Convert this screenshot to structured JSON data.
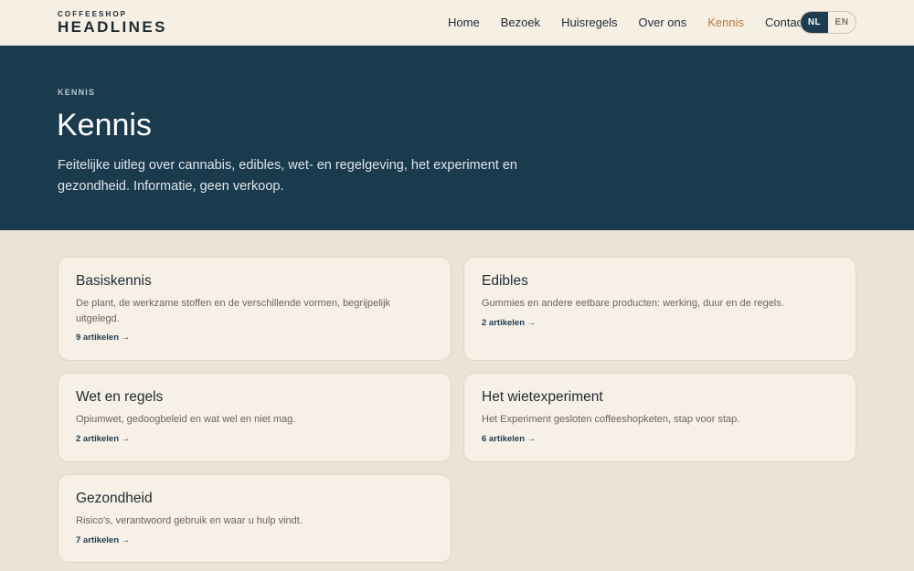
{
  "header": {
    "logo_small": "COFFEESHOP",
    "logo_big": "HEADLINES",
    "nav": [
      {
        "label": "Home"
      },
      {
        "label": "Bezoek"
      },
      {
        "label": "Huisregels"
      },
      {
        "label": "Over ons"
      },
      {
        "label": "Kennis"
      },
      {
        "label": "Contact"
      }
    ],
    "active_nav": "Kennis",
    "lang": {
      "nl": "NL",
      "en": "EN",
      "selected": "NL"
    }
  },
  "hero": {
    "breadcrumb": "KENNIS",
    "title": "Kennis",
    "subtitle": "Feitelijke uitleg over cannabis, edibles, wet- en regelgeving, het experiment en gezondheid. Informatie, geen verkoop."
  },
  "cards": [
    {
      "title": "Basiskennis",
      "description": "De plant, de werkzame stoffen en de verschillende vormen, begrijpelijk uitgelegd.",
      "link": "9 artikelen →"
    },
    {
      "title": "Edibles",
      "description": "Gummies en andere eetbare producten: werking, duur en de regels.",
      "link": "2 artikelen →"
    },
    {
      "title": "Wet en regels",
      "description": "Opiumwet, gedoogbeleid en wat wel en niet mag.",
      "link": "2 artikelen →"
    },
    {
      "title": "Het wietexperiment",
      "description": "Het Experiment gesloten coffeeshopketen, stap voor stap.",
      "link": "6 artikelen →"
    },
    {
      "title": "Gezondheid",
      "description": "Risico's, verantwoord gebruik en waar u hulp vindt.",
      "link": "7 artikelen →"
    }
  ],
  "colors": {
    "header_bg": "#f5efe4",
    "hero_bg": "#1a3a4e",
    "page_bg": "#ede3d5",
    "card_bg": "#f6f0e6",
    "accent": "#b8753a",
    "link": "#1d3c50"
  }
}
